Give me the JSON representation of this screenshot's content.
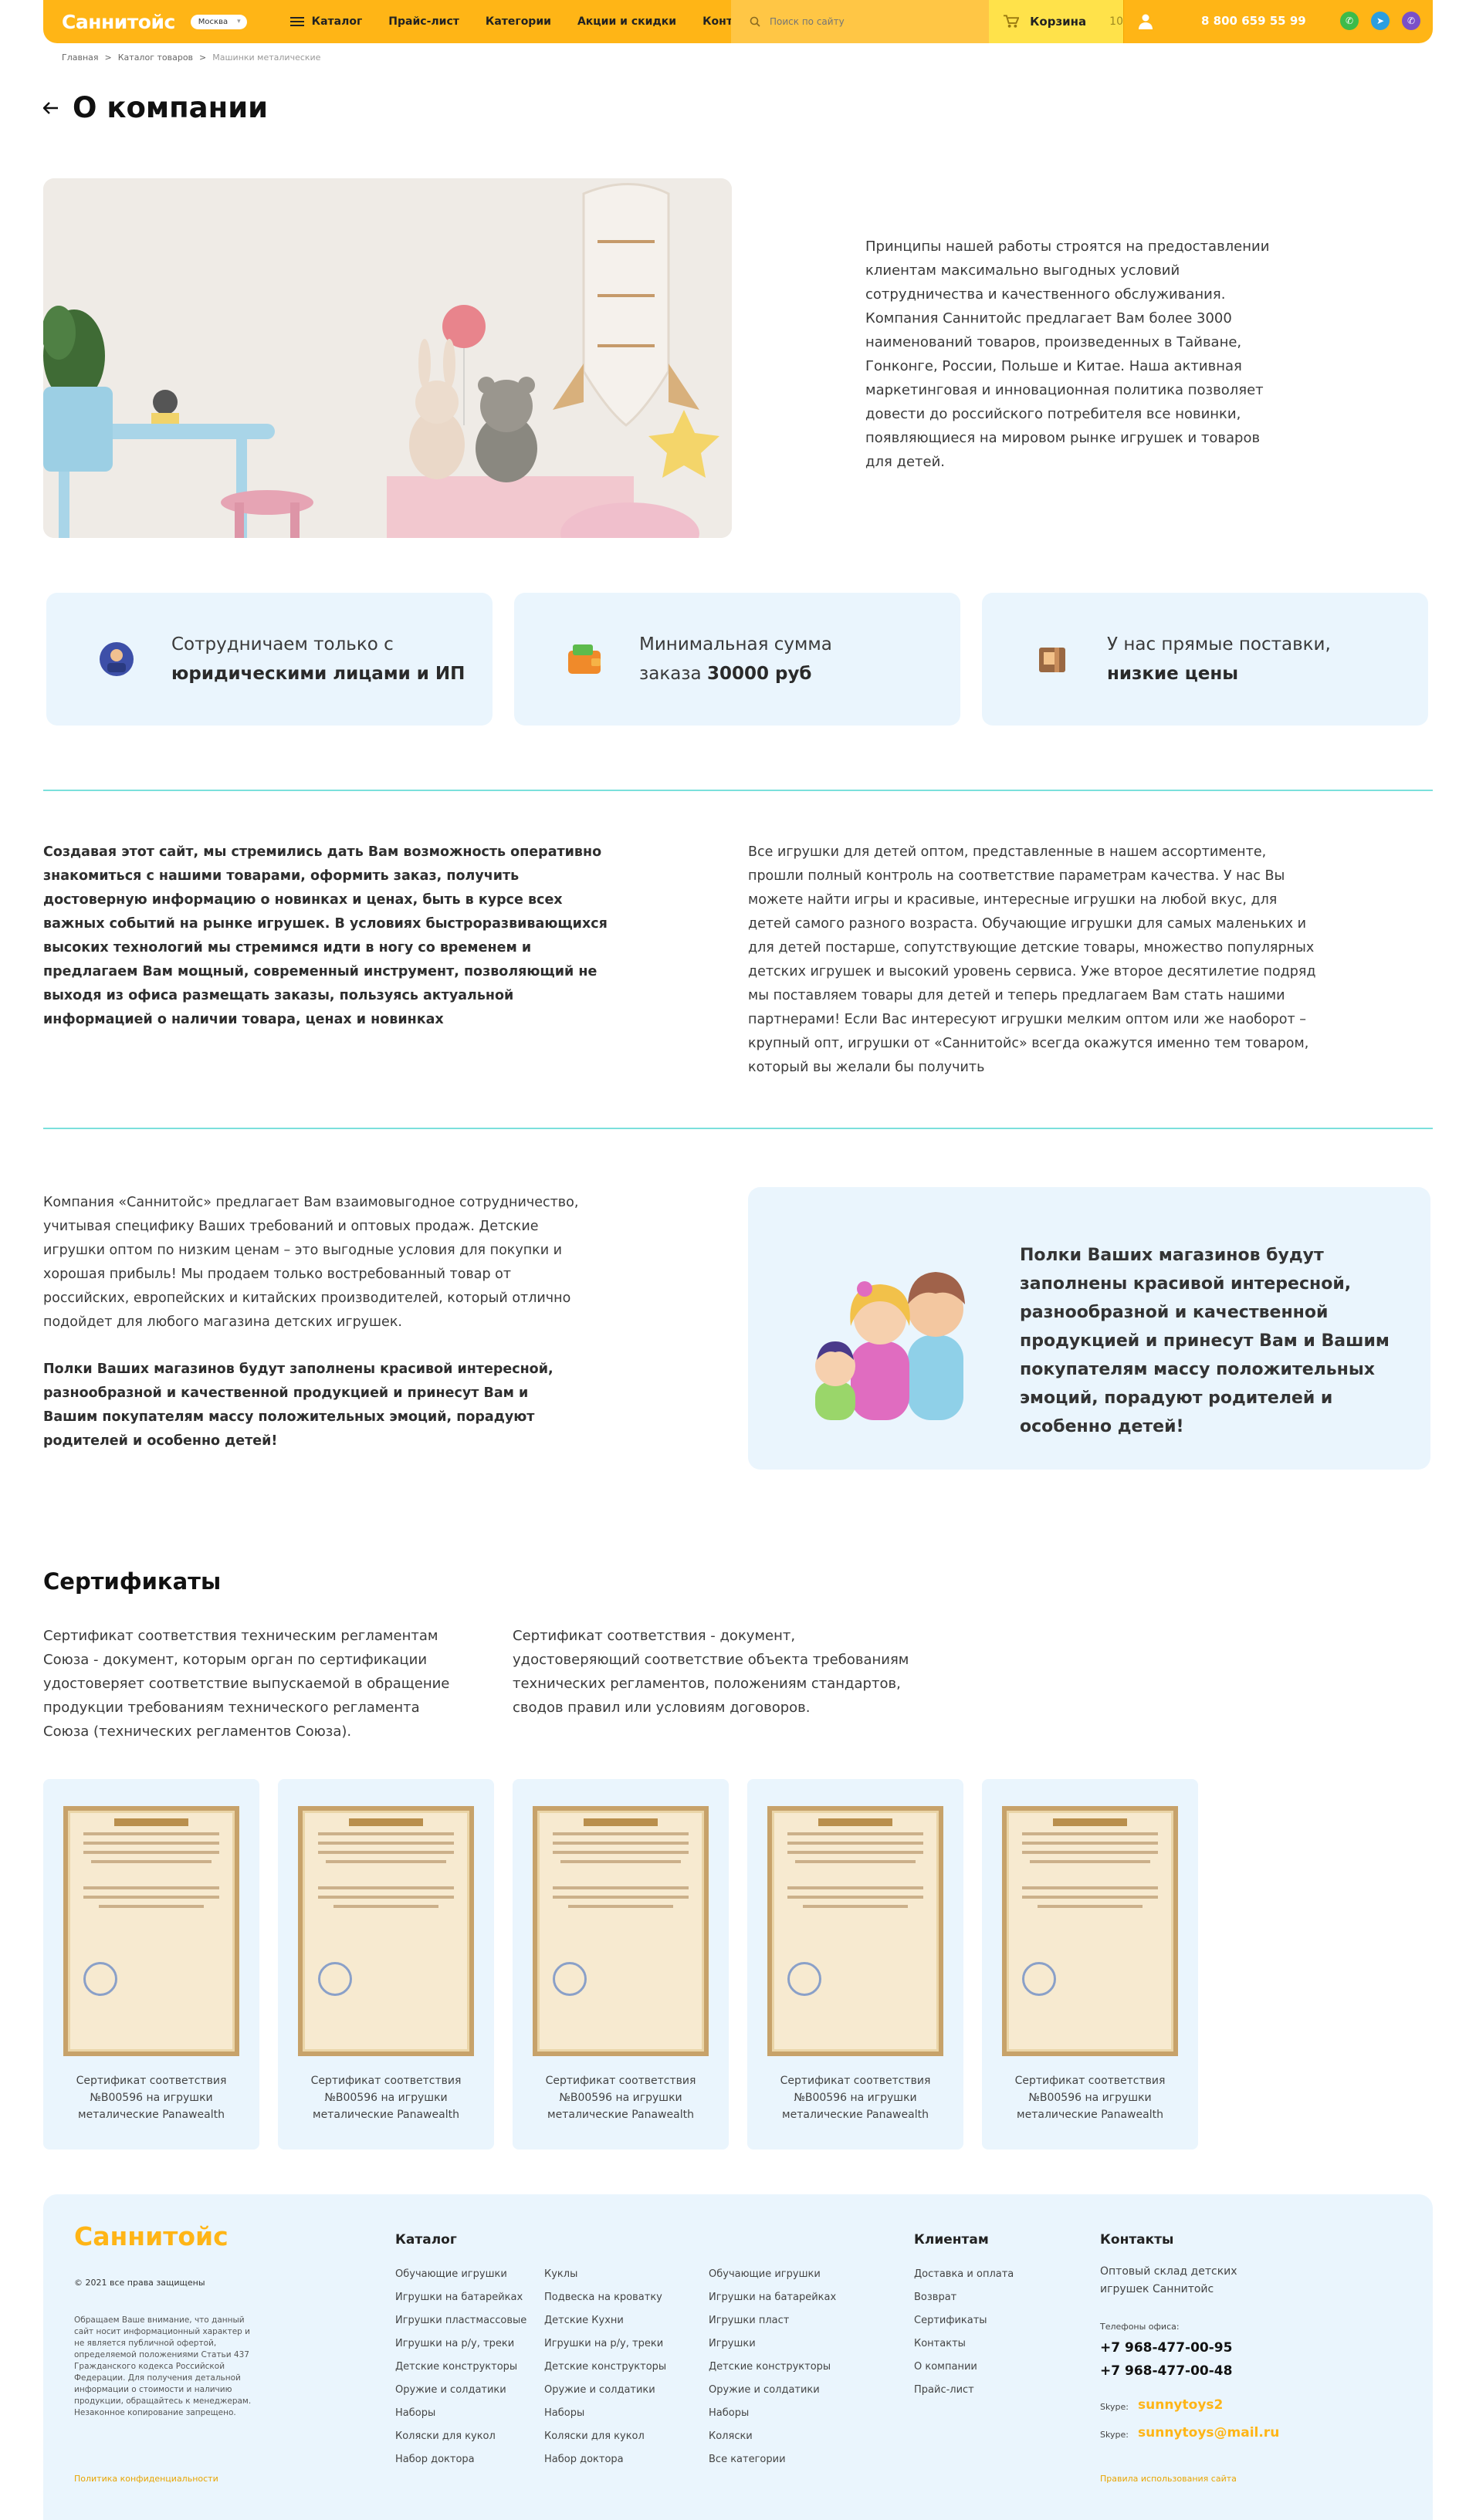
{
  "header": {
    "logo": "Саннитойс",
    "city": "Москва",
    "nav": [
      "Каталог",
      "Прайс-лист",
      "Категории",
      "Акции и скидки",
      "Контакты"
    ],
    "search_placeholder": "Поиск по сайту",
    "cart_label": "Корзина",
    "cart_count": "10",
    "phone": "8 800 659 55 99"
  },
  "breadcrumbs": [
    "Главная",
    ">",
    "Каталог товаров",
    ">",
    "Машинки металические"
  ],
  "page_title": "О компании",
  "intro": "Принципы нашей работы строятся на предоставлении клиентам максимально выгодных условий сотрудничества и качественного обслуживания. Компания Саннитойс предлагает Вам более 3000 наименований товаров, произведенных в Тайване, Гонконге, России, Польше и Китае. Наша активная маркетинговая и инновационная политика позволяет довести до российского потребителя все новинки, появляющиеся на мировом рынке игрушек и товаров для детей.",
  "features": [
    {
      "line1": "Сотрудничаем только с",
      "line2": "юридическими лицами и ИП"
    },
    {
      "line1": "Минимальная сумма",
      "line2_pre": "заказа ",
      "line2_bold": "30000 руб"
    },
    {
      "line1": "У нас прямые поставки,",
      "line2": "низкие цены"
    }
  ],
  "section2": {
    "left_bold": "Создавая этот сайт, мы стремились дать Вам возможность оперативно знакомиться с нашими товарами, оформить заказ, получить достоверную информацию о новинках и ценах, быть в курсе всех важных событий на рынке игрушек. В условиях быстроразвивающихся высоких технологий мы стремимся идти в ногу со временем и предлагаем Вам мощный, современный инструмент, позволяющий не выходя из офиса размещать заказы, пользуясь актуальной информацией о наличии товара, ценах и новинках",
    "right": "Все игрушки для детей оптом, представленные в нашем ассортименте, прошли полный контроль на соответствие параметрам качества. У нас Вы можете найти игры и красивые, интересные игрушки на любой вкус, для детей самого разного возраста. Обучающие игрушки для самых маленьких и для детей постарше, сопутствующие детские товары, множество популярных детских игрушек и высокий уровень сервиса. Уже второе десятилетие подряд мы поставляем товары для детей и теперь предлагаем Вам стать нашими партнерами! Если Вас интересуют игрушки мелким оптом или же наоборот – крупный опт, игрушки от «Саннитойс» всегда окажутся именно тем товаром, который вы желали бы получить"
  },
  "section3": {
    "left": "Компания «Саннитойс» предлагает Вам взаимовыгодное сотрудничество, учитывая специфику Ваших требований и оптовых продаж. Детские игрушки оптом по низким ценам – это выгодные условия для покупки и хорошая прибыль! Мы продаем только востребованный товар от российских, европейских и китайских производителей, который отлично подойдет для любого магазина детских игрушек.",
    "left_bold": "Полки Ваших магазинов будут заполнены красивой интересной, разнообразной и качественной продукцией и принесут Вам и Вашим покупателям массу положительных эмоций, порадуют родителей и особенно детей!",
    "box_text": "Полки Ваших магазинов будут заполнены красивой интересной, разнообразной и качественной продукцией и принесут Вам и Вашим покупателям массу положительных эмоций, порадуют родителей и особенно детей!"
  },
  "certificates": {
    "title": "Сертификаты",
    "desc1": "Сертификат соответствия техническим регламентам Союза - документ, которым орган по сертификации удостоверяет соответствие выпускаемой в обращение продукции требованиям технического регламента Союза (технических регламентов Союза).",
    "desc2": "Сертификат соответствия - документ, удостоверяющий соответствие объекта требованиям технических регламентов, положениям стандартов, сводов правил или условиям договоров.",
    "items": [
      "Сертификат соответствия №B00596 на игрушки металические Panawealth",
      "Сертификат соответствия №B00596 на игрушки металические Panawealth",
      "Сертификат соответствия №B00596 на игрушки металические Panawealth",
      "Сертификат соответствия №B00596 на игрушки металические Panawealth",
      "Сертификат соответствия №B00596 на игрушки металические Panawealth"
    ]
  },
  "footer": {
    "logo": "Саннитойс",
    "copyright": "© 2021 все права защищены",
    "note": "Обращаем Ваше внимание, что данный сайт носит информационный характер и не является публичной офертой, определяемой положениями Статьи 437 Гражданского кодекса Российской Федерации. Для получения детальной информации о стоимости и наличию продукции, обращайтесь к менеджерам. Незаконное копирование запрещено.",
    "policy": "Политика конфиденциальности",
    "catalog_title": "Каталог",
    "catalog_col1": [
      "Обучающие игрушки",
      "Игрушки на батарейках",
      "Игрушки пластмассовые",
      "Игрушки на р/у, треки",
      "Детские конструкторы",
      "Оружие и солдатики",
      "Наборы",
      "Коляски для кукол",
      "Набор доктора"
    ],
    "catalog_col2": [
      "Куклы",
      "Подвеска на кроватку",
      "Детские Кухни",
      "Игрушки на р/у, треки",
      "Детские конструкторы",
      "Оружие и солдатики",
      "Наборы",
      "Коляски для кукол",
      "Набор доктора"
    ],
    "catalog_col3": [
      "Обучающие игрушки",
      "Игрушки на батарейках",
      "Игрушки пласт",
      "Игрушки",
      "Детские конструкторы",
      "Оружие и солдатики",
      "Наборы",
      "Коляски",
      "Все категории"
    ],
    "clients_title": "Клиентам",
    "clients": [
      "Доставка и оплата",
      "Возврат",
      "Сертификаты",
      "Контакты",
      "О компании",
      "Прайс-лист"
    ],
    "contacts_title": "Контакты",
    "contacts_sub": "Оптовый склад детских игрушек Саннитойс",
    "phones_label": "Телефоны офиса:",
    "phone1": "+7 968-477-00-95",
    "phone2": "+7 968-477-00-48",
    "skype_label": "Skype:",
    "skype": "sunnytoys2",
    "email_label": "Skype:",
    "email": "sunnytoys@mail.ru",
    "rules": "Правила использования сайта"
  },
  "colors": {
    "accent": "#ffb516",
    "light_bg": "#eaf5fd",
    "divider": "#7be0dc"
  }
}
